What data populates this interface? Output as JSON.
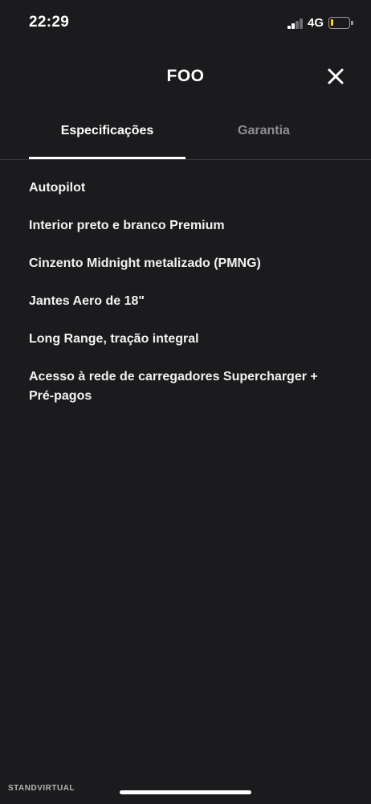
{
  "status_bar": {
    "time": "22:29",
    "network": "4G",
    "battery_level": 0.15,
    "battery_color": "#ffd60a"
  },
  "header": {
    "title": "FOO",
    "close_icon": "close-icon"
  },
  "tabs": [
    {
      "label": "Especificações",
      "active": true
    },
    {
      "label": "Garantia",
      "active": false
    }
  ],
  "specs": [
    "Autopilot",
    "Interior preto e branco Premium",
    "Cinzento Midnight metalizado (PMNG)",
    "Jantes Aero de 18\"",
    "Long Range, tração integral",
    "Acesso à rede de carregadores Supercharger + Pré-pagos"
  ],
  "watermark": "STANDVIRTUAL"
}
